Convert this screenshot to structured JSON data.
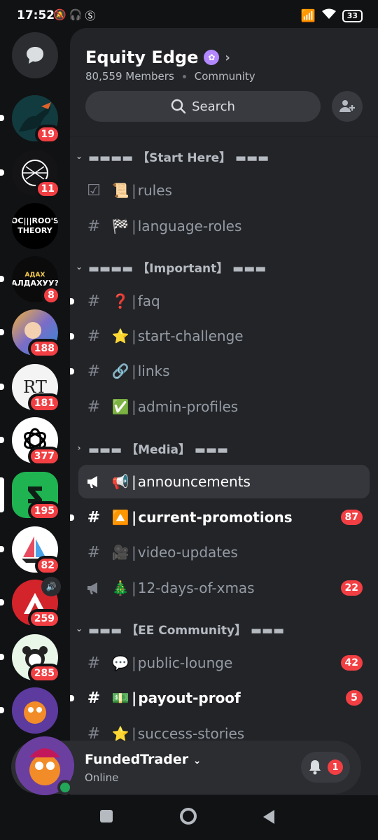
{
  "status": {
    "time": "17:52",
    "battery": "33"
  },
  "server": {
    "name": "Equity Edge",
    "members": "80,559 Members",
    "type": "Community"
  },
  "search": {
    "label": "Search"
  },
  "guilds": [
    {
      "name": "guild-1",
      "badge": "19",
      "bg": "#123b3f"
    },
    {
      "name": "guild-2",
      "badge": "11",
      "bg": "#141416"
    },
    {
      "name": "guild-ocroos",
      "badge": "",
      "bg": "#000000",
      "text1": "OC|||ROO'S",
      "text2": "THEORY"
    },
    {
      "name": "guild-4",
      "badge": "8",
      "bg": "#0b0b0b",
      "text1": "АДАХ",
      "text2": "АЛДАХУУ?"
    },
    {
      "name": "guild-5",
      "badge": "188",
      "bg": "#7b6cc7"
    },
    {
      "name": "guild-rt",
      "badge": "181",
      "bg": "#f4f4f4",
      "text1": "RT"
    },
    {
      "name": "guild-7",
      "badge": "377",
      "bg": "#ffffff"
    },
    {
      "name": "guild-8",
      "badge": "195",
      "bg": "#1fb352"
    },
    {
      "name": "guild-9",
      "badge": "82",
      "bg": "#ffffff"
    },
    {
      "name": "guild-10",
      "badge": "259",
      "bg": "#d3242b"
    },
    {
      "name": "guild-11",
      "badge": "285",
      "bg": "#e8f7e8"
    },
    {
      "name": "guild-12",
      "badge": "",
      "bg": "#5c3a9e"
    }
  ],
  "categories": [
    {
      "label": "▬▬▬▬ 【Start Here】 ▬▬▬",
      "expanded": true
    },
    {
      "label": "▬▬▬▬ 【Important】 ▬▬▬",
      "expanded": true
    },
    {
      "label": "▬▬▬ 【Media】 ▬▬▬",
      "expanded": false
    },
    {
      "label": "▬▬▬ 【EE Community】 ▬▬▬",
      "expanded": true
    }
  ],
  "channels": [
    {
      "icon": "☑",
      "emoji": "📜",
      "name": "rules",
      "badge": ""
    },
    {
      "icon": "#",
      "emoji": "🏁",
      "name": "language-roles",
      "badge": ""
    },
    {
      "icon": "#",
      "emoji": "❓",
      "name": "faq",
      "badge": ""
    },
    {
      "icon": "#",
      "emoji": "⭐",
      "name": "start-challenge",
      "badge": ""
    },
    {
      "icon": "#",
      "emoji": "🔗",
      "name": "links",
      "badge": ""
    },
    {
      "icon": "#",
      "emoji": "✅",
      "name": "admin-profiles",
      "badge": ""
    },
    {
      "icon": "📢",
      "emoji": "📢",
      "name": "announcements",
      "badge": ""
    },
    {
      "icon": "#",
      "emoji": "🔼",
      "name": "current-promotions",
      "badge": "87"
    },
    {
      "icon": "#",
      "emoji": "🎥",
      "name": "video-updates",
      "badge": ""
    },
    {
      "icon": "📢",
      "emoji": "🎄",
      "name": "12-days-of-xmas",
      "badge": "22"
    },
    {
      "icon": "#",
      "emoji": "💬",
      "name": "public-lounge",
      "badge": "42"
    },
    {
      "icon": "#",
      "emoji": "💵",
      "name": "payout-proof",
      "badge": "5"
    },
    {
      "icon": "#",
      "emoji": "⭐",
      "name": "success-stories",
      "badge": ""
    }
  ],
  "user": {
    "name": "FundedTrader",
    "status": "Online",
    "notifications": "1"
  }
}
